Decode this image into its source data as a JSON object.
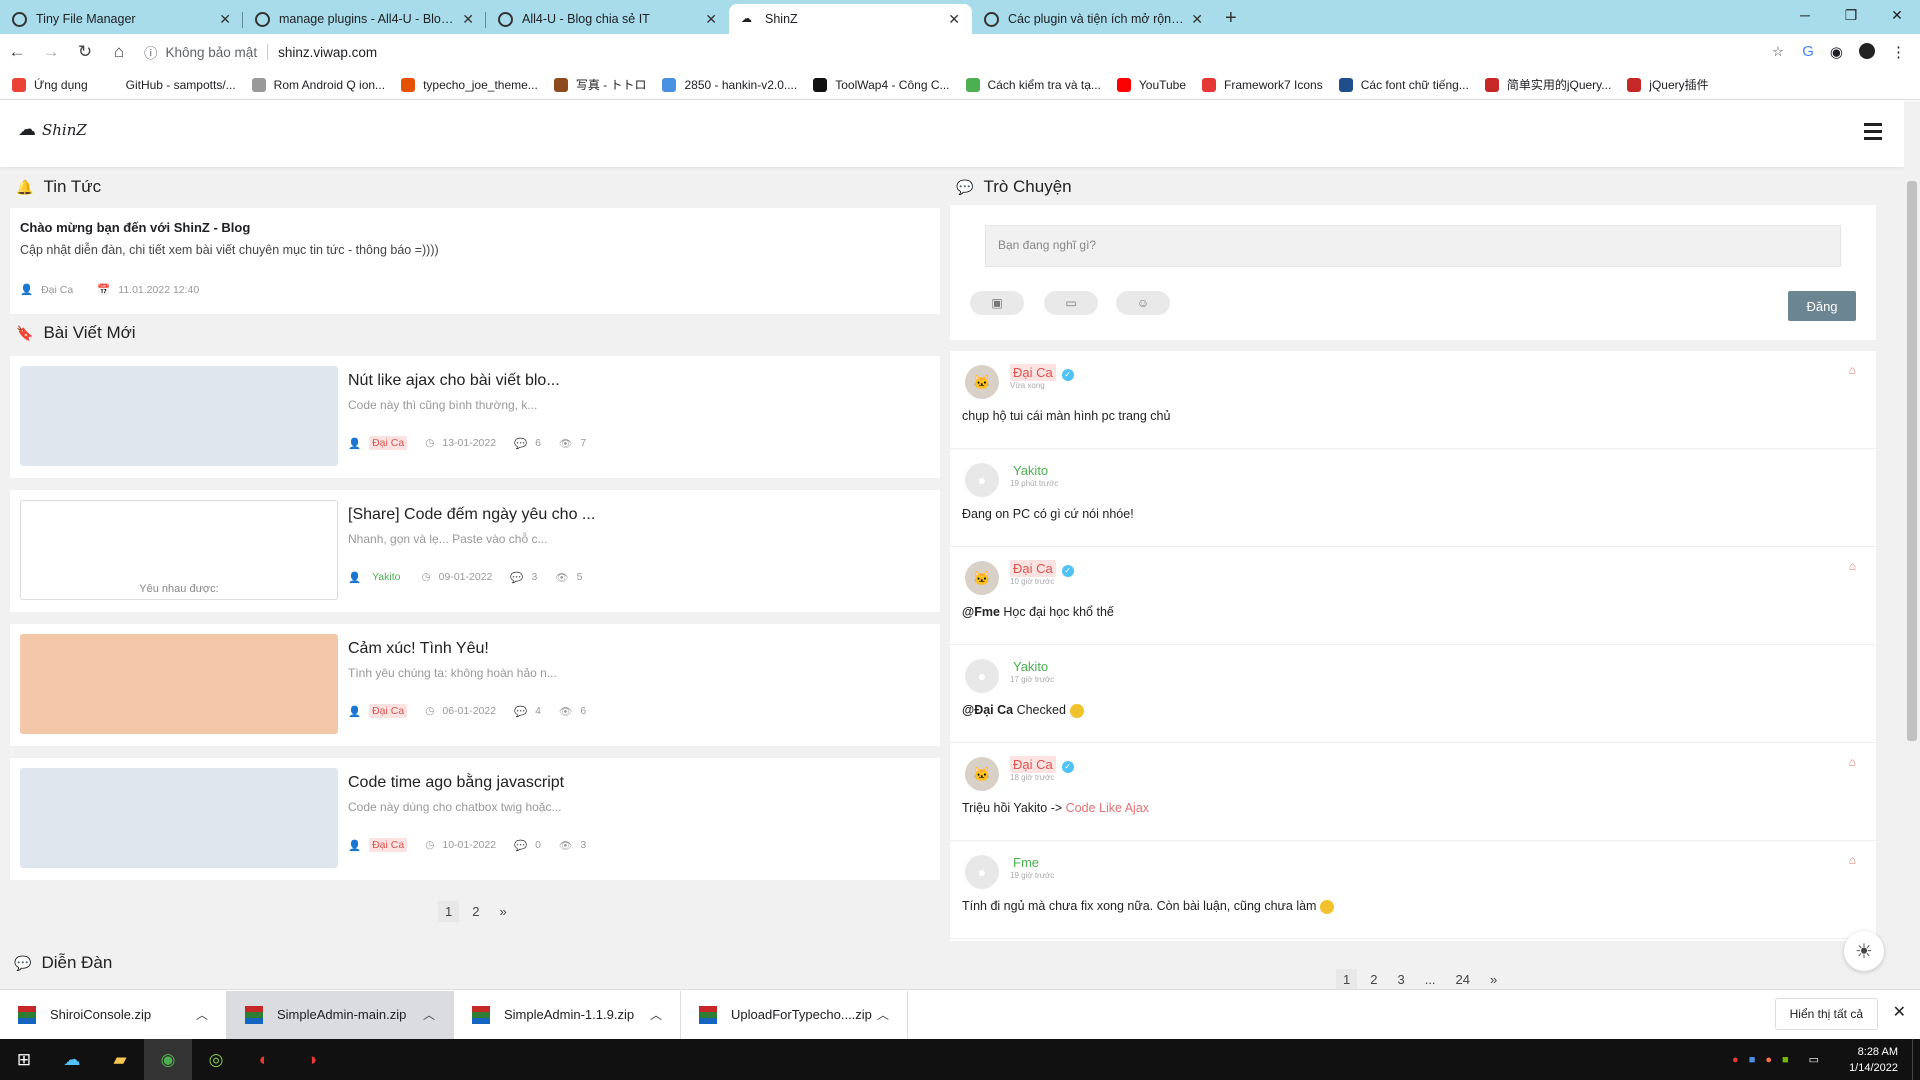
{
  "browser": {
    "tabs": [
      {
        "title": "Tiny File Manager"
      },
      {
        "title": "manage plugins - All4-U - Blog c"
      },
      {
        "title": "All4-U - Blog chia sẻ IT"
      },
      {
        "title": "ShinZ"
      },
      {
        "title": "Các plugin và tiện ích mở rộng -"
      }
    ],
    "security_label": "Không bảo mật",
    "url": "shinz.viwap.com",
    "bookmarks": [
      {
        "label": "Ứng dụng",
        "color": "#ea4335"
      },
      {
        "label": "GitHub - sampotts/...",
        "color": "#ffffff"
      },
      {
        "label": "Rom Android Q ion...",
        "color": "#999999"
      },
      {
        "label": "typecho_joe_theme...",
        "color": "#e65100"
      },
      {
        "label": "写真 - トトロ",
        "color": "#8d4a1c"
      },
      {
        "label": "2850 - hankin-v2.0....",
        "color": "#4a90e2"
      },
      {
        "label": "ToolWap4 - Công C...",
        "color": "#111111"
      },
      {
        "label": "Cách kiểm tra và tạ...",
        "color": "#4caf50"
      },
      {
        "label": "YouTube",
        "color": "#ff0000"
      },
      {
        "label": "Framework7 Icons",
        "color": "#e53935"
      },
      {
        "label": "Các font chữ tiếng...",
        "color": "#1e4f8a"
      },
      {
        "label": "简单实用的jQuery...",
        "color": "#c62828"
      },
      {
        "label": "jQuery插件",
        "color": "#c62828"
      }
    ]
  },
  "site": {
    "logo": "ShinZ",
    "news": {
      "section": "Tin Tức",
      "headline": "Chào mừng bạn đến với ShinZ - Blog",
      "desc": "Cập nhật diễn đàn, chi tiết xem bài viết chuyên mục tin tức - thông báo =))))",
      "author": "Đại Ca",
      "date": "11.01.2022 12:40"
    },
    "posts_section": "Bài Viết Mới",
    "posts": [
      {
        "title": "Nút like ajax cho bài viết blo...",
        "desc": "Code này thì cũng bình thường, k...",
        "author": "Đại Ca",
        "date": "13-01-2022",
        "comments": "6",
        "views": "7",
        "thumb": "#dfe6ee"
      },
      {
        "title": "[Share] Code đếm ngày yêu cho ...",
        "desc": "Nhanh, gọn và lẹ... Paste vào chỗ c...",
        "author": "Yakito",
        "date": "09-01-2022",
        "comments": "3",
        "views": "5",
        "thumb": "#ffffff",
        "thumb_text": "Yêu nhau được:"
      },
      {
        "title": "Cảm xúc! Tình Yêu!",
        "desc": "Tình yêu chúng ta: không hoàn hảo n...",
        "author": "Đại Ca",
        "date": "06-01-2022",
        "comments": "4",
        "views": "6",
        "thumb": "#f4c7a8"
      },
      {
        "title": "Code time ago bằng javascript",
        "desc": "Code này dùng cho chatbox twig hoặc...",
        "author": "Đại Ca",
        "date": "10-01-2022",
        "comments": "0",
        "views": "3",
        "thumb": "#dfe6ee"
      }
    ],
    "posts_pager": [
      "1",
      "2",
      "»"
    ],
    "forum_section": "Diễn Đàn",
    "chat": {
      "section": "Trò Chuyện",
      "placeholder": "Bạn đang nghĩ gì?",
      "post_button": "Đăng",
      "messages": [
        {
          "user": "Đại Ca",
          "time": "Vừa xong",
          "text": "chụp hộ tui cái màn hình pc trang chủ",
          "verified": true
        },
        {
          "user": "Yakito",
          "time": "19 phút trước",
          "text": "Đang on PC có gì cứ nói nhóe!",
          "verified": false
        },
        {
          "user": "Đại Ca",
          "time": "10 giờ trước",
          "mention": "@Fme",
          "text": " Học đại học khổ thế",
          "verified": true
        },
        {
          "user": "Yakito",
          "time": "17 giờ trước",
          "mention": "@Đại Ca",
          "text": " Checked",
          "verified": false
        },
        {
          "user": "Đại Ca",
          "time": "18 giờ trước",
          "text": "Triệu hồi Yakito -> ",
          "link": "Code Like Ajax",
          "verified": true
        },
        {
          "user": "Fme",
          "time": "19 giờ trước",
          "text": "Tính đi ngủ mà chưa fix xong nữa. Còn bài luận, cũng chưa làm",
          "verified": false
        }
      ],
      "pager": [
        "1",
        "2",
        "3",
        "...",
        "24",
        "»"
      ]
    }
  },
  "downloads": {
    "items": [
      "ShiroiConsole.zip",
      "SimpleAdmin-main.zip",
      "SimpleAdmin-1.1.9.zip",
      "UploadForTypecho....zip"
    ],
    "show_all": "Hiển thị tất cả"
  },
  "taskbar": {
    "time": "8:28 AM",
    "date": "1/14/2022"
  }
}
